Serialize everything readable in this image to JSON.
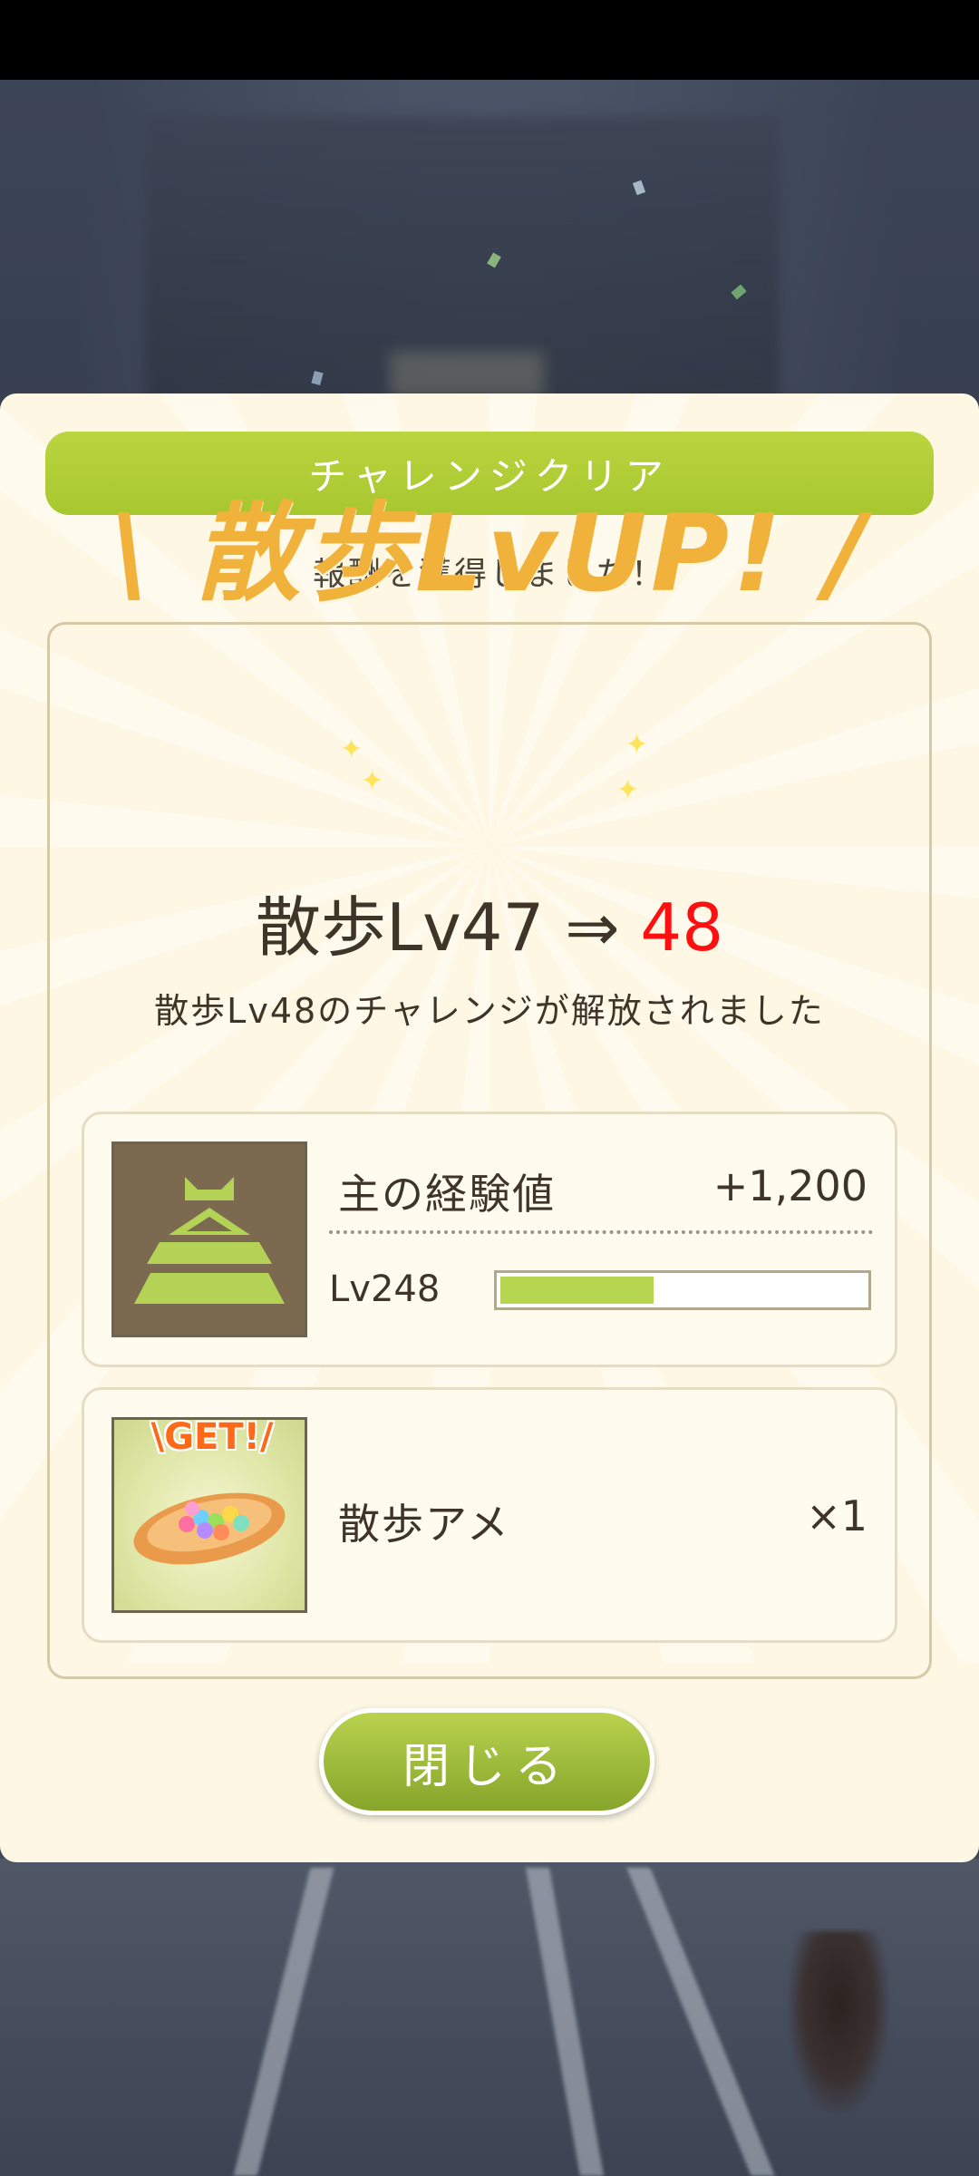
{
  "title_bar": {
    "label": "チャレンジクリア"
  },
  "subtitle": "報酬を獲得しました！",
  "level_up": {
    "banner": "\\ 散歩LvUP! /",
    "from_label": "散歩Lv47",
    "arrow": "⇒",
    "to_value": "48",
    "unlock_message": "散歩Lv48のチャレンジが解放されました"
  },
  "rewards": [
    {
      "icon": "castle-icon",
      "label": "主の経験値",
      "value": "+1,200",
      "level_label": "Lv248",
      "progress_fraction": 0.42
    },
    {
      "icon": "candy-dish-icon",
      "badge": "\\GET!/",
      "label": "散歩アメ",
      "value": "×1"
    }
  ],
  "close_button": {
    "label": "閉じる"
  },
  "colors": {
    "accent_green": "#a8c72f",
    "banner_orange": "#f1b23b",
    "new_level_red": "#ff1010",
    "panel_bg": "#fdf7e4"
  }
}
